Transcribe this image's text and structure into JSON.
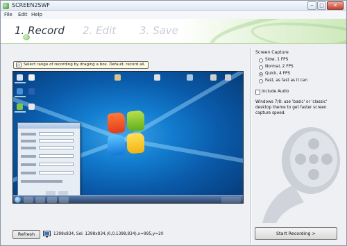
{
  "window": {
    "title": "SCREEN2SWF"
  },
  "window_controls": {
    "minimize": "─",
    "maximize": "□",
    "close": "✕"
  },
  "menu": [
    "File",
    "Edit",
    "Help"
  ],
  "steps": {
    "step1": "1. Record",
    "step2": "2. Edit",
    "step3": "3. Save"
  },
  "hint": {
    "text": "Select range of recording by draging a box. Default, record all."
  },
  "footer": {
    "refresh_label": "Refresh",
    "status": "1398x834, Sel. 1398x834,(0,0,1398,834),x=995,y=20"
  },
  "screen_capture": {
    "title": "Screen Capture",
    "options": [
      {
        "label": "Slow, 1 FPS",
        "selected": false
      },
      {
        "label": "Normal, 2 FPS",
        "selected": false
      },
      {
        "label": "Quick, 4 FPS",
        "selected": true
      },
      {
        "label": "Fast, as fast as it can",
        "selected": false
      }
    ],
    "include_audio": {
      "label": "Include Audio",
      "checked": false
    },
    "note": "Windows 7/8: use 'basic' or 'classic' desktop theme to get faster screen capture speed.",
    "start_label": "Start Recording >"
  },
  "icons": [
    "app-icon",
    "hint-icon",
    "monitor-icon",
    "film-reel-icon"
  ]
}
